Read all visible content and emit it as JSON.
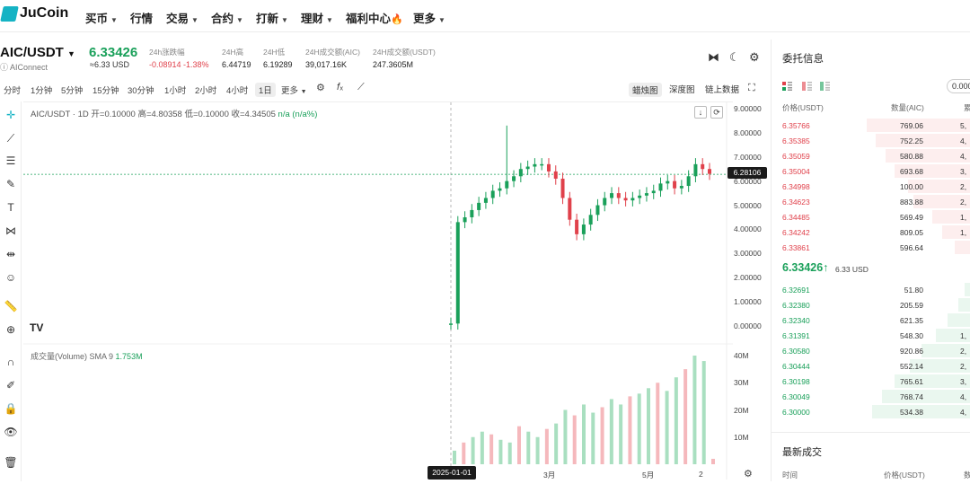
{
  "brand": {
    "name": "JuCoin"
  },
  "nav": {
    "items": [
      {
        "label": "买币",
        "caret": true
      },
      {
        "label": "行情",
        "caret": false
      },
      {
        "label": "交易",
        "caret": true
      },
      {
        "label": "合约",
        "caret": true
      },
      {
        "label": "打新",
        "caret": true
      },
      {
        "label": "理财",
        "caret": true
      },
      {
        "label": "福利中心",
        "caret": false,
        "flame": "🔥"
      },
      {
        "label": "更多",
        "caret": true
      }
    ]
  },
  "ticker": {
    "pair": "AIC/USDT",
    "project": "AIConnect",
    "last_price": "6.33426",
    "last_price_usd": "≈6.33 USD",
    "stats": [
      {
        "label": "24h涨跌幅",
        "value": "-0.08914 -1.38%",
        "negative": true
      },
      {
        "label": "24H高",
        "value": "6.44719",
        "negative": false
      },
      {
        "label": "24H低",
        "value": "6.19289",
        "negative": false
      },
      {
        "label": "24H成交额(AIC)",
        "value": "39,017.16K",
        "negative": false
      },
      {
        "label": "24H成交额(USDT)",
        "value": "247.3605M",
        "negative": false
      }
    ]
  },
  "toolbar": {
    "timeframes": [
      "分时",
      "1分钟",
      "5分钟",
      "15分钟",
      "30分钟",
      "1小时",
      "2小时",
      "4小时",
      "1日",
      "更多"
    ],
    "active_timeframe": "1日",
    "views": [
      "蜡烛图",
      "深度图",
      "链上数据"
    ],
    "active_view": "蜡烛图"
  },
  "chart": {
    "legend": {
      "symbol": "AIC/USDT · 1D",
      "open": "开=0.10000",
      "high": "高=4.80358",
      "low": "低=0.10000",
      "close": "收=4.34505",
      "change": "n/a (n/a%)"
    },
    "volume_legend": {
      "label": "成交量(Volume) SMA 9",
      "value": "1.753M"
    },
    "price_tag": "6.28106",
    "date_tag": "2025-01-01",
    "x_ticks": [
      "3月",
      "5月",
      "2"
    ],
    "volume_ticks": [
      "40M",
      "30M",
      "20M",
      "10M"
    ],
    "watermark": "TV"
  },
  "chart_data": {
    "type": "candlestick",
    "title": "AIC/USDT · 1D",
    "ylim": [
      0,
      9
    ],
    "yticks": [
      "9.00000",
      "8.00000",
      "7.00000",
      "6.00000",
      "5.00000",
      "4.00000",
      "3.00000",
      "2.00000",
      "1.00000",
      "0.00000"
    ],
    "x_range": [
      "2025-01-01",
      "2025-06-02"
    ],
    "price_path": [
      0.1,
      4.3,
      4.5,
      4.8,
      5.1,
      5.3,
      5.6,
      5.7,
      6.0,
      6.2,
      6.5,
      6.6,
      6.7,
      6.7,
      6.4,
      6.1,
      5.3,
      4.4,
      3.8,
      4.2,
      4.6,
      5.0,
      5.3,
      5.5,
      5.3,
      5.2,
      5.3,
      5.4,
      5.5,
      5.6,
      5.9,
      6.0,
      5.7,
      5.8,
      6.2,
      6.7,
      6.5,
      6.3
    ],
    "volume_ylim": [
      0,
      40
    ],
    "volume_path_M": [
      5,
      8,
      10,
      12,
      11,
      9,
      8,
      14,
      12,
      10,
      13,
      15,
      20,
      18,
      22,
      19,
      21,
      24,
      22,
      25,
      26,
      28,
      30,
      27,
      32,
      35,
      40,
      38,
      2
    ]
  },
  "orderbook": {
    "title": "委托信息",
    "precision": "0.000",
    "headers": {
      "price": "价格(USDT)",
      "qty": "数量(AIC)",
      "total": "累"
    },
    "asks": [
      {
        "price": "6.35766",
        "qty": "769.06",
        "total": "5,",
        "depth": 0.55
      },
      {
        "price": "6.35385",
        "qty": "752.25",
        "total": "4,",
        "depth": 0.5
      },
      {
        "price": "6.35059",
        "qty": "580.88",
        "total": "4,",
        "depth": 0.45
      },
      {
        "price": "6.35004",
        "qty": "693.68",
        "total": "3,",
        "depth": 0.4
      },
      {
        "price": "6.34998",
        "qty": "100.00",
        "total": "2,",
        "depth": 0.33
      },
      {
        "price": "6.34623",
        "qty": "883.88",
        "total": "2,",
        "depth": 0.3
      },
      {
        "price": "6.34485",
        "qty": "569.49",
        "total": "1,",
        "depth": 0.2
      },
      {
        "price": "6.34242",
        "qty": "809.05",
        "total": "1,",
        "depth": 0.15
      },
      {
        "price": "6.33861",
        "qty": "596.64",
        "total": "",
        "depth": 0.08
      }
    ],
    "mid_price": "6.33426↑",
    "mid_usd": "6.33 USD",
    "bids": [
      {
        "price": "6.32691",
        "qty": "51.80",
        "total": "",
        "depth": 0.03
      },
      {
        "price": "6.32380",
        "qty": "205.59",
        "total": "",
        "depth": 0.06
      },
      {
        "price": "6.32340",
        "qty": "621.35",
        "total": "",
        "depth": 0.12
      },
      {
        "price": "6.31391",
        "qty": "548.30",
        "total": "1,",
        "depth": 0.18
      },
      {
        "price": "6.30580",
        "qty": "920.86",
        "total": "2,",
        "depth": 0.26
      },
      {
        "price": "6.30444",
        "qty": "552.14",
        "total": "2,",
        "depth": 0.32
      },
      {
        "price": "6.30198",
        "qty": "765.61",
        "total": "3,",
        "depth": 0.4
      },
      {
        "price": "6.30049",
        "qty": "768.74",
        "total": "4,",
        "depth": 0.47
      },
      {
        "price": "6.30000",
        "qty": "534.38",
        "total": "4,",
        "depth": 0.52
      }
    ]
  },
  "trades": {
    "title": "最新成交",
    "headers": {
      "time": "时间",
      "price": "价格(USDT)",
      "qty": "数"
    }
  },
  "colors": {
    "up": "#1aa05a",
    "down": "#e0414b",
    "brand": "#15b3c4"
  }
}
